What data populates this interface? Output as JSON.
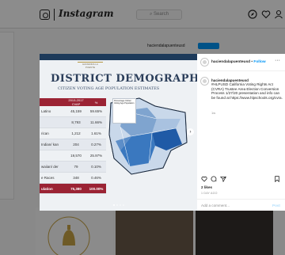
{
  "app": {
    "wordmark": "Instagram",
    "search_placeholder": "⌕ Search"
  },
  "profile_bg": {
    "username": "haciendalapuenteusd",
    "follow_label": "Follow"
  },
  "slide": {
    "title": "DISTRICT DEMOGRAPHICS",
    "subtitle": "CITIZEN VOTING AGE POPULATION ESTIMATES",
    "logo_text": "HACIENDA LA PUENTE",
    "table_header": {
      "label": "",
      "col1": "2013-2017 CVAP",
      "col2": "%"
    },
    "table_rows": [
      {
        "label": "Latino",
        "num": "45,159",
        "pct": "59.65%"
      },
      {
        "label": "",
        "num": "8,793",
        "pct": "11.66%"
      },
      {
        "label": "rican",
        "num": "1,212",
        "pct": "1.61%"
      },
      {
        "label": "Indian/\nkan",
        "num": "204",
        "pct": "0.27%"
      },
      {
        "label": "",
        "num": "19,570",
        "pct": "25.97%"
      },
      {
        "label": "waiian/\nder",
        "num": "79",
        "pct": "0.10%"
      },
      {
        "label": "e Races",
        "num": "348",
        "pct": "0.46%"
      }
    ],
    "table_total": {
      "label": "ulation",
      "num": "75,380",
      "pct": "100.00%"
    },
    "legend_title": "Percentage Citizen Voting Age Population"
  },
  "post": {
    "username": "haciendalapuenteusd",
    "separator": "•",
    "follow_label": "Follow",
    "caption_user": "haciendalapuenteusd",
    "caption": "#HLPUSD California Voting Rights Act (CVRA) Trustee Area Election Conversion Process 1/27/20 presentation and info can be found at https://www.hlpschools.org/cvra.",
    "caption_time": "1w",
    "likes": "2 likes",
    "time_ago": "1 DAY AGO",
    "comment_placeholder": "Add a comment...",
    "post_label": "Post"
  },
  "colors": {
    "accent": "#0095f6",
    "slide_red": "#9b2334",
    "slide_navy": "#2b3e5a"
  },
  "icons": [
    "instagram-logo-icon",
    "compass-icon",
    "heart-icon",
    "user-icon",
    "more-icon",
    "chevron-right-icon",
    "comment-icon",
    "share-icon",
    "bookmark-icon"
  ]
}
